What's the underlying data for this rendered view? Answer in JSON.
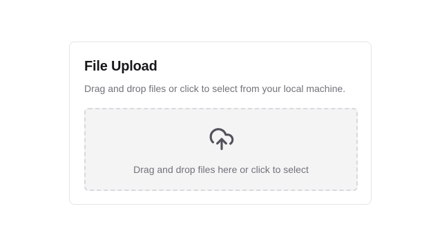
{
  "upload_card": {
    "title": "File Upload",
    "description": "Drag and drop files or click to select from your local machine.",
    "dropzone": {
      "text": "Drag and drop files here or click to select",
      "icon": "cloud-upload-icon"
    }
  },
  "colors": {
    "title": "#18181b",
    "muted_text": "#71717a",
    "card_border": "#e4e4e7",
    "dropzone_bg": "#f4f4f5",
    "dropzone_border": "#d9d9de",
    "icon": "#52525b"
  }
}
